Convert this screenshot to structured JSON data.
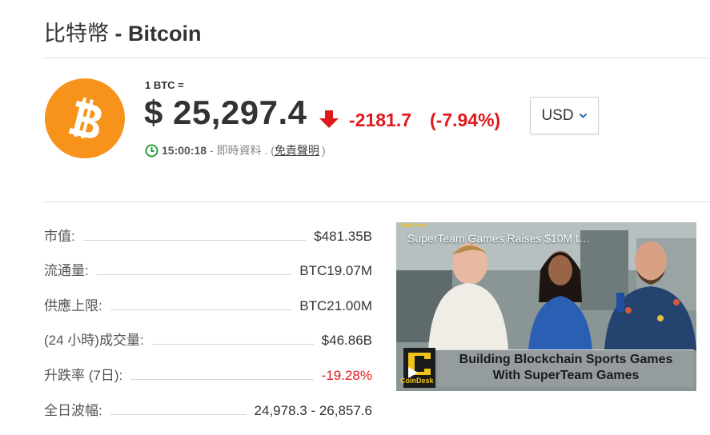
{
  "page": {
    "title_zh": "比特幣",
    "title_en": " - Bitcoin"
  },
  "quote": {
    "unit_label": "1 BTC =",
    "price": "$ 25,297.4",
    "change": "-2181.7",
    "change_pct": "(-7.94%)",
    "time": "15:00:18",
    "time_suffix": "- 即時資料 . (",
    "disclaimer": "免責聲明",
    "close_paren": ")",
    "currency": "USD",
    "colors": {
      "down": "#e0191c",
      "coin": "#f7931a",
      "clock": "#2e9e3e"
    }
  },
  "stats": [
    {
      "label": "市值:",
      "value": "$481.35B"
    },
    {
      "label": "流通量:",
      "value": "BTC19.07M"
    },
    {
      "label": "供應上限:",
      "value": "BTC21.00M"
    },
    {
      "label": "(24 小時)成交量:",
      "value": "$46.86B"
    },
    {
      "label": "升跌率 (7日):",
      "value": "-19.28%"
    },
    {
      "label": "全日波幅:",
      "value": "24,978.3 - 26,857.6"
    }
  ],
  "video": {
    "title": "SuperTeam Games Raises $10M t…",
    "brand_top": "CoinDesk",
    "brand_bottom": "CoinDesk",
    "banner_line1": "Building Blockchain Sports Games",
    "banner_line2": "With SuperTeam Games"
  }
}
